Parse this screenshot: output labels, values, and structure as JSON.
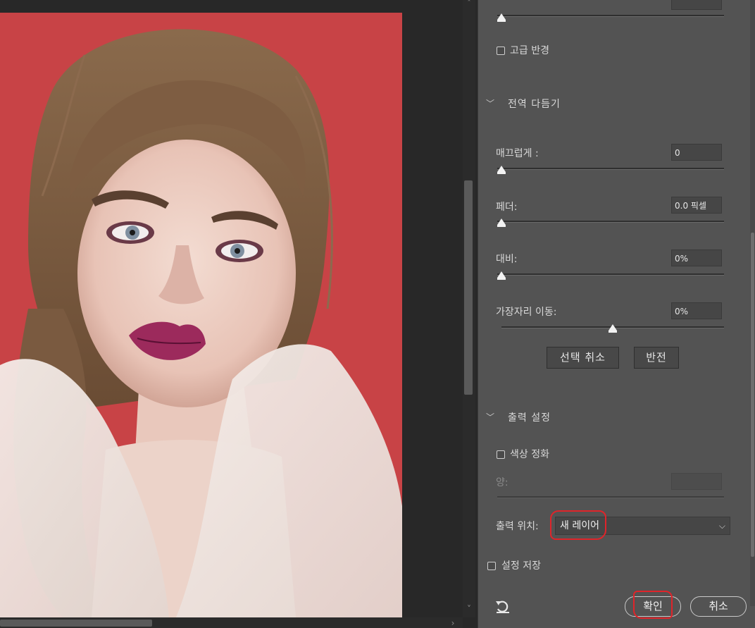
{
  "panel": {
    "advanced_radius_label": "고급 반경",
    "global_refinement": {
      "title": "전역 다듬기",
      "smooth": {
        "label": "매끄럽게 :",
        "value": "0",
        "level": 0
      },
      "feather": {
        "label": "페더:",
        "value": "0.0 픽셀",
        "level": 0
      },
      "contrast": {
        "label": "대비:",
        "value": "0%",
        "level": 0
      },
      "shift_edge": {
        "label": "가장자리 이동:",
        "value": "0%",
        "level": 0.5
      },
      "deselect_button": "선택 취소",
      "invert_button": "반전"
    },
    "output_settings": {
      "title": "출력 설정",
      "decontaminate_label": "색상 정화",
      "amount_label": "양:",
      "amount_value": "",
      "output_to_label": "출력 위치:",
      "output_to_value": "새 레이어"
    },
    "remember_settings_label": "설정 저장",
    "ok_button": "확인",
    "cancel_button": "취소"
  },
  "colors": {
    "photo_background": "#c84346",
    "panel_background": "#535353",
    "annotation": "#e0242a"
  },
  "icons": {
    "reset": "reset-icon",
    "chevron": "chevron-down-icon",
    "select_arrow": "dropdown-arrow-icon"
  }
}
